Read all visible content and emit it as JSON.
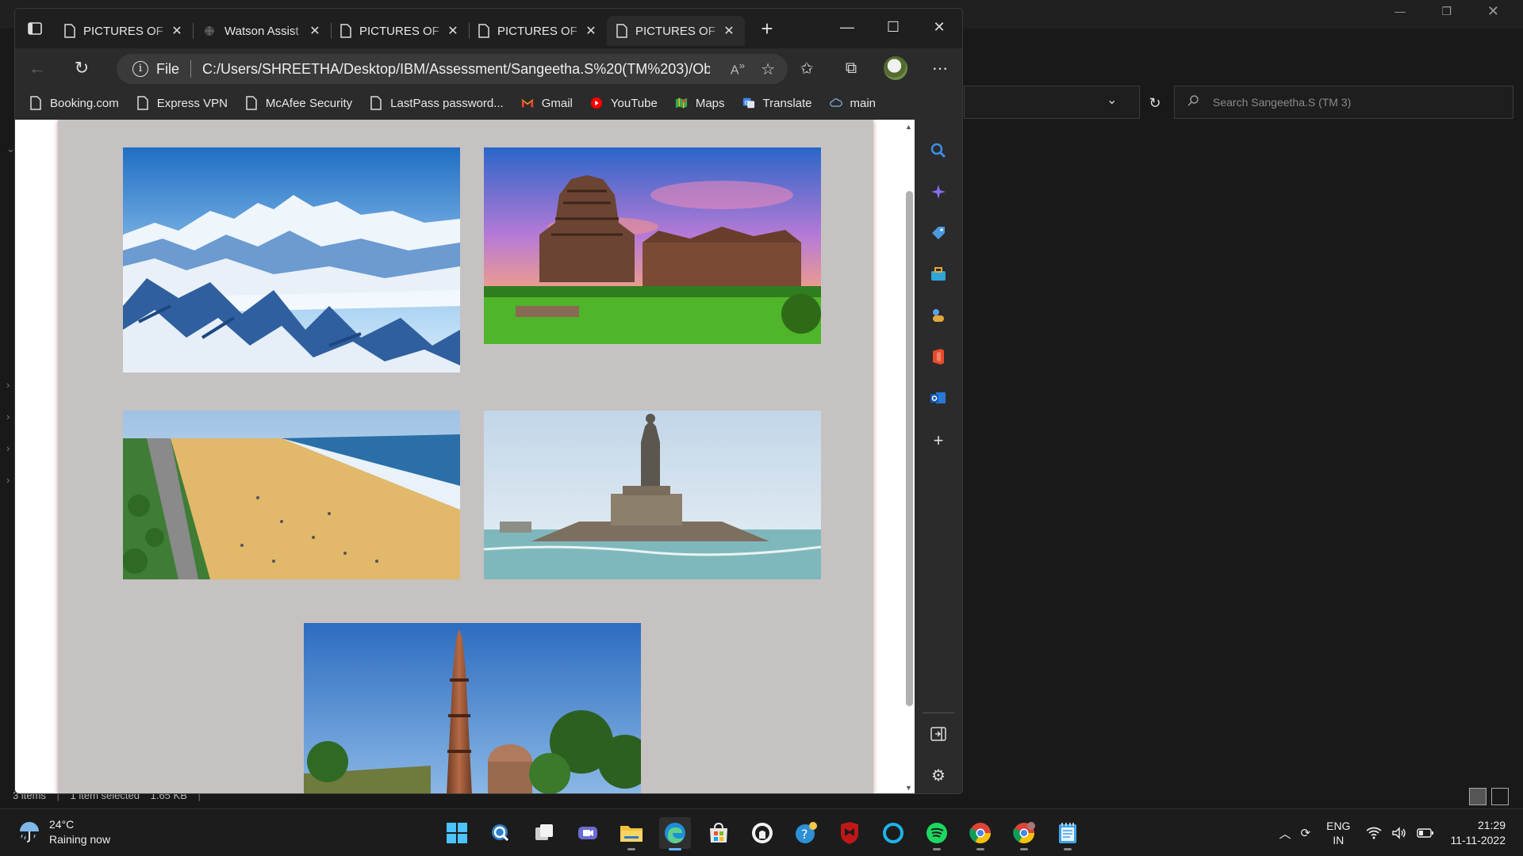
{
  "explorer": {
    "search_placeholder": "Search Sangeetha.S (TM 3)",
    "status": {
      "items": "3 items",
      "selected": "1 item selected",
      "size": "1.65 KB"
    }
  },
  "browser": {
    "tabs": [
      {
        "title": "PICTURES OF",
        "active": false
      },
      {
        "title": "Watson Assist",
        "active": false
      },
      {
        "title": "PICTURES OF",
        "active": false
      },
      {
        "title": "PICTURES OF",
        "active": false
      },
      {
        "title": "PICTURES OF",
        "active": true
      }
    ],
    "address": {
      "scheme": "File",
      "url": "C:/Users/SHREETHA/Desktop/IBM/Assessment/Sangeetha.S%20(TM%203)/Obe..."
    },
    "bookmarks": [
      {
        "label": "Booking.com",
        "icon": "page-icon"
      },
      {
        "label": "Express VPN",
        "icon": "page-icon"
      },
      {
        "label": "McAfee Security",
        "icon": "page-icon"
      },
      {
        "label": "LastPass password...",
        "icon": "page-icon"
      },
      {
        "label": "Gmail",
        "icon": "gmail-icon"
      },
      {
        "label": "YouTube",
        "icon": "youtube-icon"
      },
      {
        "label": "Maps",
        "icon": "maps-icon"
      },
      {
        "label": "Translate",
        "icon": "translate-icon"
      },
      {
        "label": "main",
        "icon": "cloud-icon"
      }
    ],
    "images": [
      {
        "name": "photo-snow-mountains",
        "subject": "Snow-capped Himalayan mountain range"
      },
      {
        "name": "photo-sun-temple",
        "subject": "Stone temple at sunset"
      },
      {
        "name": "photo-beach",
        "subject": "Sandy city beach"
      },
      {
        "name": "photo-statue-sea",
        "subject": "Statue on rock in the sea"
      },
      {
        "name": "photo-minaret",
        "subject": "Tall brick minaret"
      }
    ]
  },
  "taskbar": {
    "weather": {
      "temp": "24°C",
      "condition": "Raining now"
    },
    "language": {
      "line1": "ENG",
      "line2": "IN"
    },
    "clock": {
      "time": "21:29",
      "date": "11-11-2022"
    }
  },
  "colors": {
    "page_panel": "#c6c2c2",
    "accent": "#5fb2ff"
  }
}
